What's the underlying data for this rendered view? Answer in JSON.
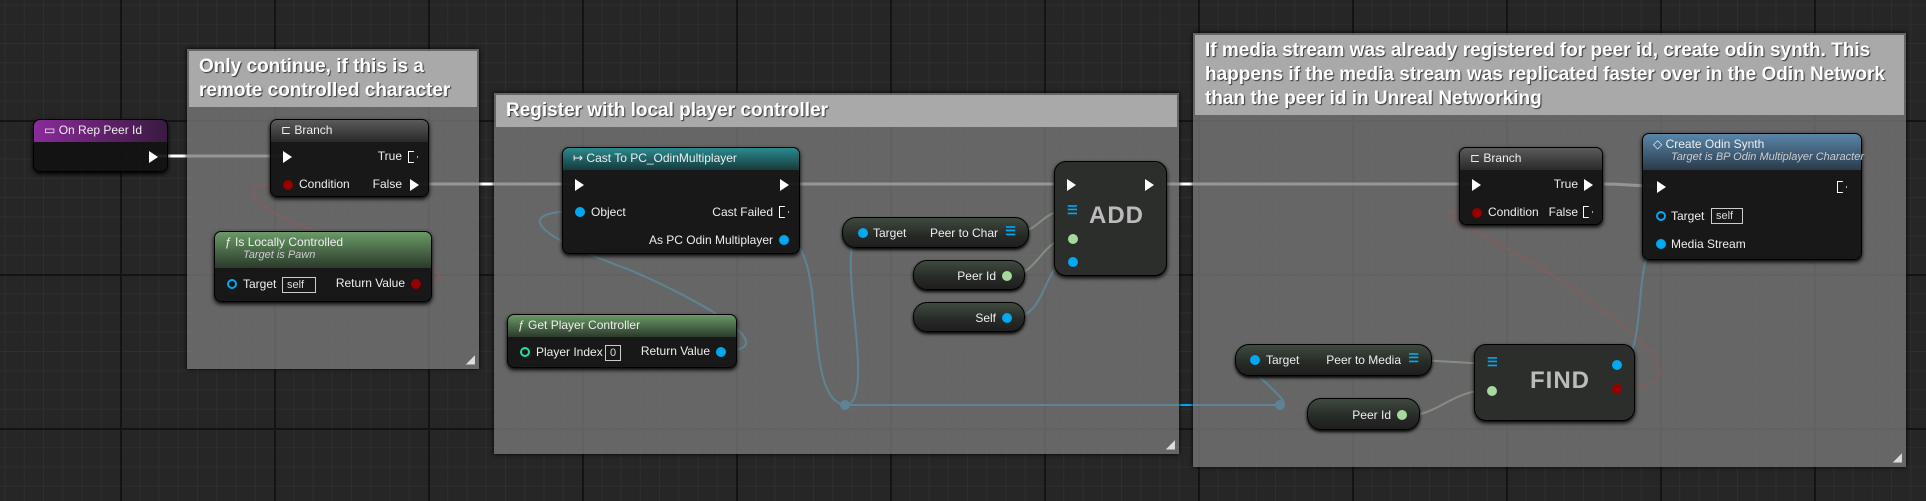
{
  "comments": [
    {
      "text": "Only continue, if this is a remote controlled character"
    },
    {
      "text": "Register with local player controller"
    },
    {
      "text": "If media stream was already registered for peer id, create odin synth. This happens if the media stream was replicated faster over in the Odin Network than the peer id in Unreal Networking"
    }
  ],
  "nodes": {
    "on_rep": {
      "title": "On Rep Peer Id"
    },
    "branch1": {
      "title": "Branch",
      "condition": "Condition",
      "true": "True",
      "false": "False"
    },
    "is_locally": {
      "title": "Is Locally Controlled",
      "subtitle": "Target is Pawn",
      "target": "Target",
      "target_value": "self",
      "return": "Return Value"
    },
    "cast": {
      "title": "Cast To PC_OdinMultiplayer",
      "object": "Object",
      "cast_failed": "Cast Failed",
      "as_pc": "As PC Odin Multiplayer"
    },
    "get_pc": {
      "title": "Get Player Controller",
      "player_index": "Player Index",
      "player_index_value": "0",
      "return": "Return Value"
    },
    "peer_to_char": {
      "target": "Target",
      "out": "Peer to Char"
    },
    "peer_id1": {
      "out": "Peer Id"
    },
    "self": {
      "out": "Self"
    },
    "add": {
      "label": "ADD"
    },
    "branch2": {
      "title": "Branch",
      "condition": "Condition",
      "true": "True",
      "false": "False"
    },
    "create_synth": {
      "title": "Create Odin Synth",
      "subtitle": "Target is BP Odin Multiplayer Character",
      "target": "Target",
      "target_value": "self",
      "media_stream": "Media Stream"
    },
    "peer_to_media": {
      "target": "Target",
      "out": "Peer to Media"
    },
    "peer_id2": {
      "out": "Peer Id"
    },
    "find": {
      "label": "FIND"
    }
  },
  "colors": {
    "exec": "#ffffff",
    "bool": "#950000",
    "object": "#00a8f0",
    "int": "#1fe0a0",
    "name": "#b0d8a0",
    "event": "#7a1f8a",
    "pure_func": "#5e8a5a",
    "cast": "#1e6e72",
    "func": "#4a6e8e"
  }
}
